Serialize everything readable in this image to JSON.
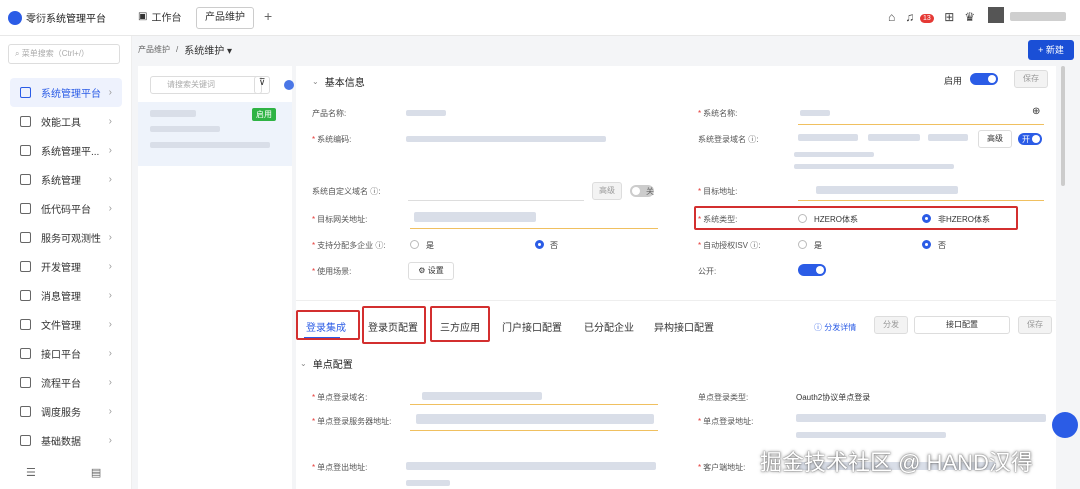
{
  "app": {
    "name": "零衍系统管理平台"
  },
  "top_tabs": {
    "work": "工作台",
    "active": "产品维护",
    "add": "+"
  },
  "notifications": {
    "count": "13"
  },
  "sidebar": {
    "search_placeholder": "菜单搜索（Ctrl+/）",
    "items": [
      {
        "label": "系统管理平台"
      },
      {
        "label": "效能工具"
      },
      {
        "label": "系统管理平..."
      },
      {
        "label": "系统管理"
      },
      {
        "label": "低代码平台"
      },
      {
        "label": "服务可观测性"
      },
      {
        "label": "开发管理"
      },
      {
        "label": "消息管理"
      },
      {
        "label": "文件管理"
      },
      {
        "label": "接口平台"
      },
      {
        "label": "流程平台"
      },
      {
        "label": "调度服务"
      },
      {
        "label": "基础数据"
      }
    ]
  },
  "breadcrumb": {
    "parent": "产品维护",
    "sep": "/",
    "current": "系统维护 ▾"
  },
  "new_button": "+ 新建",
  "list": {
    "search_placeholder": "请搜索关键词",
    "status": "启用"
  },
  "basic": {
    "title": "基本信息",
    "enable_label": "启用",
    "save": "保存",
    "product_name": "产品名称:",
    "system_code": "系统编码:",
    "custom_domain": "系统自定义域名 ⓘ:",
    "advanced": "高级",
    "off": "关",
    "gateway": "目标网关地址:",
    "multi_tenant": "支持分配多企业 ⓘ:",
    "yes": "是",
    "no": "否",
    "scenario": "使用场景:",
    "settings": "⚙ 设置",
    "system_name": "系统名称:",
    "login_domain": "系统登录域名 ⓘ:",
    "on": "开",
    "target_addr": "目标地址:",
    "system_type": "系统类型:",
    "hzero": "HZERO体系",
    "non_hzero": "非HZERO体系",
    "auto_isv": "自动授权ISV ⓘ:",
    "public": "公开:"
  },
  "tabs": [
    "登录集成",
    "登录页配置",
    "三方应用",
    "门户接口配置",
    "已分配企业",
    "异构接口配置"
  ],
  "tab_actions": {
    "help": "ⓘ 分发详情",
    "distribute": "分发",
    "config": "接口配置",
    "save": "保存"
  },
  "sso": {
    "title": "单点配置",
    "domain": "单点登录域名:",
    "server": "单点登录服务器地址:",
    "logout": "单点登出地址:",
    "type_label": "单点登录类型:",
    "type_value": "Oauth2协议单点登录",
    "login_addr": "单点登录地址:",
    "client_addr": "客户端地址:"
  },
  "watermark": "掘金技术社区 @ HAND汉得"
}
